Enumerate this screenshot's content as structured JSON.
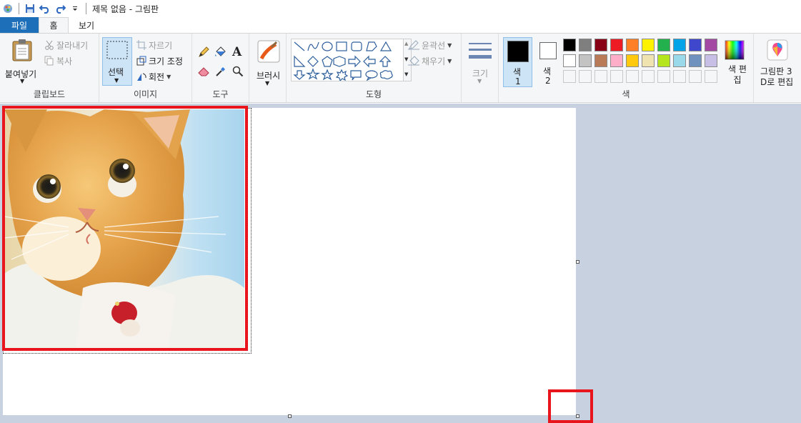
{
  "window": {
    "title": "제목 없음 - 그림판"
  },
  "tabs": {
    "file": "파일",
    "home": "홈",
    "view": "보기"
  },
  "clipboard": {
    "paste": "붙여넣기",
    "cut": "잘라내기",
    "copy": "복사",
    "group": "클립보드"
  },
  "image": {
    "select": "선택",
    "crop": "자르기",
    "resize": "크기 조정",
    "rotate": "회전",
    "group": "이미지"
  },
  "tools": {
    "group": "도구",
    "text_glyph": "A"
  },
  "brushes": {
    "label": "브러시"
  },
  "shapes": {
    "outline": "윤곽선",
    "fill": "채우기",
    "group": "도형"
  },
  "size": {
    "label": "크기"
  },
  "colors": {
    "color1": "색",
    "color1_num": "1",
    "color2": "색",
    "color2_num": "2",
    "edit": "색 편집",
    "group": "색",
    "current1": "#000000",
    "current2": "#ffffff",
    "palette_row1": [
      "#000000",
      "#7f7f7f",
      "#880015",
      "#ed1c24",
      "#ff7f27",
      "#fff200",
      "#22b14c",
      "#00a2e8",
      "#3f48cc",
      "#a349a4"
    ],
    "palette_row2": [
      "#ffffff",
      "#c3c3c3",
      "#b97a57",
      "#ffaec9",
      "#ffc90e",
      "#efe4b0",
      "#b5e61d",
      "#99d9ea",
      "#7092be",
      "#c8bfe7"
    ]
  },
  "paint3d": {
    "line1": "그림판 3",
    "line2": "D로 편집"
  },
  "annotation": {
    "highlight_color": "#e8151c"
  }
}
